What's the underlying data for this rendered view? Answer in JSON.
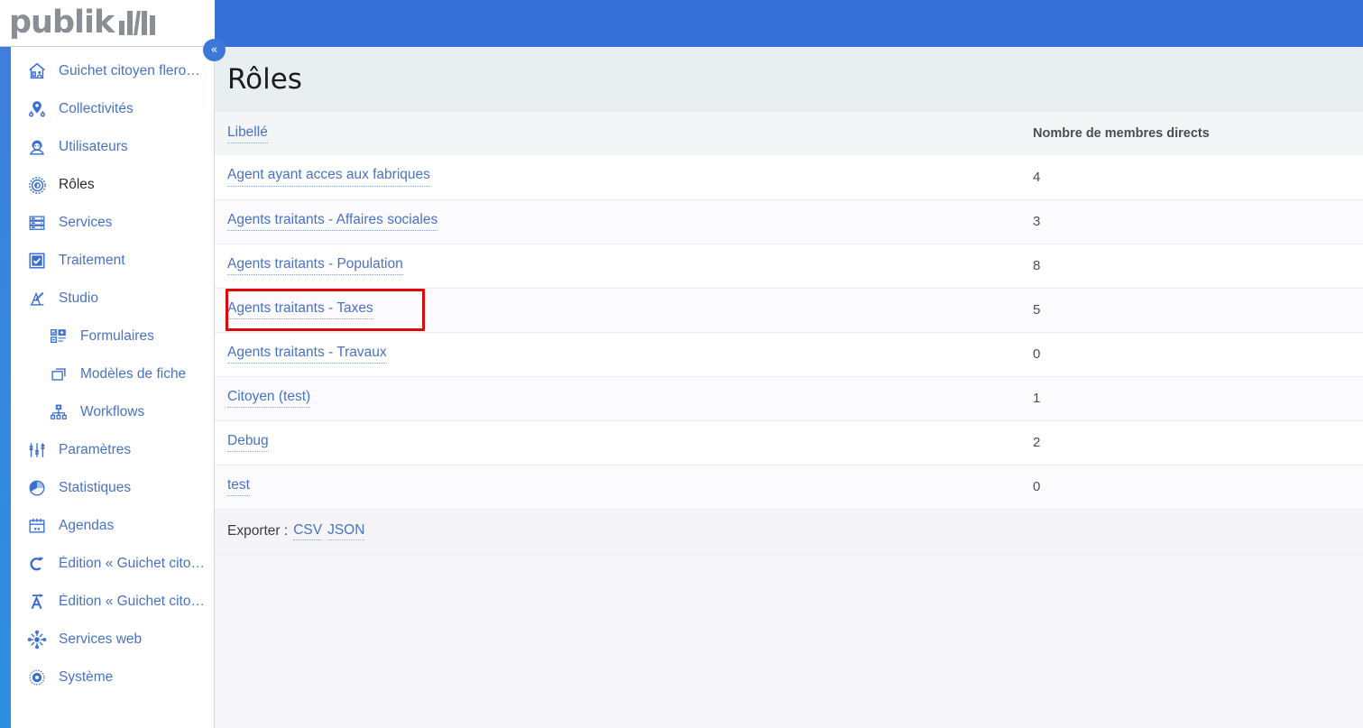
{
  "brand": {
    "name": "publik",
    "logo_icon": "publik-bars-logo"
  },
  "sidebar": {
    "collapse_icon": "chevron-double-left-icon",
    "items": [
      {
        "label": "Guichet citoyen fleron - ...",
        "icon": "home-user-icon",
        "active": false,
        "sub": false
      },
      {
        "label": "Collectivités",
        "icon": "map-pin-icon",
        "active": false,
        "sub": false
      },
      {
        "label": "Utilisateurs",
        "icon": "user-icon",
        "active": false,
        "sub": false
      },
      {
        "label": "Rôles",
        "icon": "roles-gear-icon",
        "active": true,
        "sub": false
      },
      {
        "label": "Services",
        "icon": "server-icon",
        "active": false,
        "sub": false
      },
      {
        "label": "Traitement",
        "icon": "checkbox-icon",
        "active": false,
        "sub": false
      },
      {
        "label": "Studio",
        "icon": "studio-pen-icon",
        "active": false,
        "sub": false
      },
      {
        "label": "Formulaires",
        "icon": "form-add-icon",
        "active": false,
        "sub": true
      },
      {
        "label": "Modèles de fiche",
        "icon": "cards-icon",
        "active": false,
        "sub": true
      },
      {
        "label": "Workflows",
        "icon": "workflow-icon",
        "active": false,
        "sub": true
      },
      {
        "label": "Paramètres",
        "icon": "sliders-icon",
        "active": false,
        "sub": false
      },
      {
        "label": "Statistiques",
        "icon": "pie-chart-icon",
        "active": false,
        "sub": false
      },
      {
        "label": "Agendas",
        "icon": "calendar-icon",
        "active": false,
        "sub": false
      },
      {
        "label": "Édition « Guichet citoye...",
        "icon": "edit-c-icon",
        "active": false,
        "sub": false
      },
      {
        "label": "Édition « Guichet citoye...",
        "icon": "edit-a-icon",
        "active": false,
        "sub": false
      },
      {
        "label": "Services web",
        "icon": "webservices-icon",
        "active": false,
        "sub": false
      },
      {
        "label": "Système",
        "icon": "system-gear-icon",
        "active": false,
        "sub": false
      }
    ]
  },
  "page": {
    "title": "Rôles"
  },
  "table": {
    "columns": [
      {
        "key": "label",
        "header": "Libellé",
        "sortable": true
      },
      {
        "key": "count",
        "header": "Nombre de membres directs",
        "sortable": false
      }
    ],
    "rows": [
      {
        "label": "Agent ayant acces aux fabriques",
        "count": "4"
      },
      {
        "label": "Agents traitants - Affaires sociales",
        "count": "3"
      },
      {
        "label": "Agents traitants - Population",
        "count": "8"
      },
      {
        "label": "Agents traitants - Taxes",
        "count": "5"
      },
      {
        "label": "Agents traitants - Travaux",
        "count": "0"
      },
      {
        "label": "Citoyen (test)",
        "count": "1"
      },
      {
        "label": "Debug",
        "count": "2"
      },
      {
        "label": "test",
        "count": "0"
      }
    ]
  },
  "export": {
    "label": "Exporter :",
    "csv": "CSV",
    "json": "JSON"
  },
  "annotation": {
    "highlight_target": "Agents traitants - Taxes",
    "highlight_color": "#dd0a0a"
  },
  "colors": {
    "topbar": "#3570d8",
    "accent": "#3d78d8",
    "link": "#4872c4",
    "page_head_bg": "#e9eef0"
  }
}
